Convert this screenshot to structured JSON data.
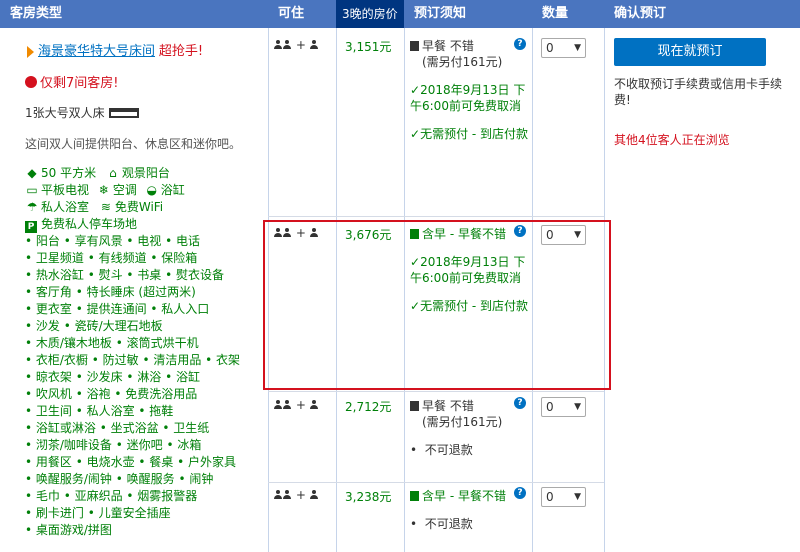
{
  "headers": {
    "room_type": "客房类型",
    "occupancy": "可住",
    "price": "3晚的房价",
    "conditions": "预订须知",
    "quantity": "数量",
    "confirm": "确认预订"
  },
  "room": {
    "name": "海景豪华特大号床间",
    "deal": "超抢手!",
    "rooms_left": "仅剩7间客房!",
    "bed": "1张大号双人床",
    "description": "这间双人间提供阳台、休息区和迷你吧。",
    "features": [
      {
        "icon": "size-icon",
        "glyph": "◆",
        "text": "50 平方米"
      },
      {
        "icon": "balcony-icon",
        "glyph": "⌂",
        "text": "观景阳台"
      },
      {
        "icon": "tv-icon",
        "glyph": "▭",
        "text": "平板电视"
      },
      {
        "icon": "ac-icon",
        "glyph": "❄",
        "text": "空调"
      },
      {
        "icon": "bathtub-icon",
        "glyph": "◒",
        "text": "浴缸"
      },
      {
        "icon": "bath-icon",
        "glyph": "☂",
        "text": "私人浴室"
      },
      {
        "icon": "wifi-icon",
        "glyph": "≋",
        "text": "免费WiFi"
      }
    ],
    "parking": "免费私人停车场地",
    "amenity_lines": [
      "• 阳台 • 享有风景 • 电视 • 电话",
      "• 卫星频道 • 有线频道 • 保险箱",
      "• 热水浴缸 • 熨斗 • 书桌 • 熨衣设备",
      "• 客厅角 • 特长睡床 (超过两米)",
      "• 更衣室 • 提供连通间 • 私人入口",
      "• 沙发 • 瓷砖/大理石地板",
      "• 木质/镶木地板 • 滚筒式烘干机",
      "• 衣柜/衣橱 • 防过敏 • 清洁用品 • 衣架",
      "• 晾衣架 • 沙发床 • 淋浴 • 浴缸",
      "• 吹风机 • 浴袍 • 免费洗浴用品",
      "• 卫生间 • 私人浴室 • 拖鞋",
      "• 浴缸或淋浴 • 坐式浴盆 • 卫生纸",
      "• 沏茶/咖啡设备 • 迷你吧 • 冰箱",
      "• 用餐区 • 电烧水壶 • 餐桌 • 户外家具",
      "• 唤醒服务/闹钟 • 唤醒服务 • 闹钟",
      "• 毛巾 • 亚麻织品 • 烟雾报警器",
      "• 刷卡进门 • 儿童安全插座",
      "• 桌面游戏/拼图"
    ]
  },
  "occupancy": "+",
  "options": [
    {
      "price": "3,151元",
      "breakfast": "早餐 不错",
      "breakfast_extra": "(需另付161元)",
      "policy_a": "2018年9月13日 下午6:00前可免费取消",
      "policy_b": "无需预付 - 到店付款",
      "qty": "0"
    },
    {
      "price": "3,676元",
      "breakfast": "含早 - 早餐不错",
      "policy_a": "2018年9月13日 下午6:00前可免费取消",
      "policy_b": "无需预付 - 到店付款",
      "qty": "0"
    },
    {
      "price": "2,712元",
      "breakfast": "早餐 不错",
      "breakfast_extra": "(需另付161元)",
      "policy_a": "不可退款",
      "qty": "0"
    },
    {
      "price": "3,238元",
      "breakfast": "含早 - 早餐不错",
      "policy_a": "不可退款",
      "qty": "0"
    }
  ],
  "confirm": {
    "button": "现在就预订",
    "no_fee": "不收取预订手续费或信用卡手续费!",
    "viewing": "其他4位客人正在浏览"
  },
  "help": "?"
}
